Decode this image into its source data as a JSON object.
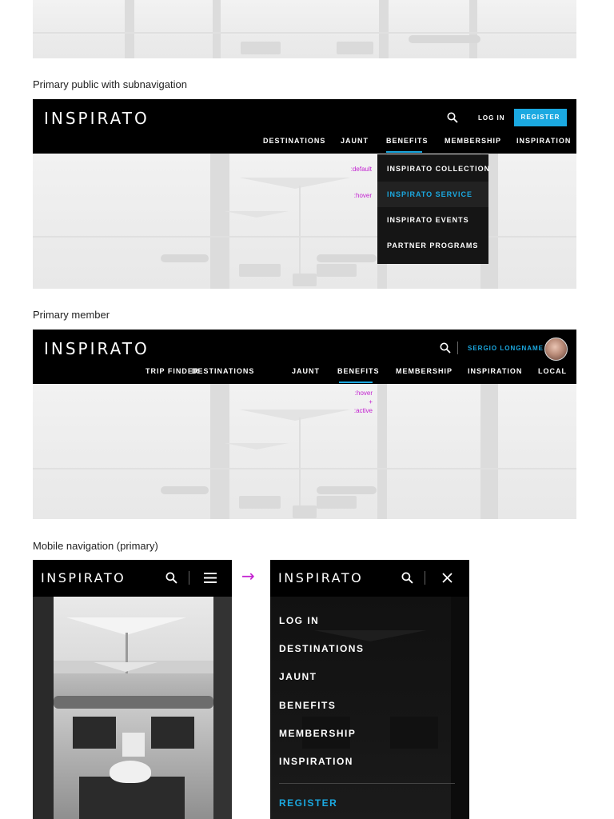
{
  "captions": {
    "public_sub": "Primary public with subnavigation",
    "member": "Primary member",
    "mobile": "Mobile navigation (primary)"
  },
  "brand": {
    "logo": "INSPIRATO"
  },
  "colors": {
    "accent": "#1ba9e1",
    "annotation": "#c21fd0",
    "nav_bg": "#000000",
    "dropdown_bg": "#151515"
  },
  "public_nav": {
    "login": "LOG IN",
    "register": "REGISTER",
    "items": [
      "DESTINATIONS",
      "JAUNT",
      "BENEFITS",
      "MEMBERSHIP",
      "INSPIRATION"
    ],
    "active_item": "BENEFITS",
    "dropdown": [
      "INSPIRATO COLLECTION",
      "INSPIRATO SERVICE",
      "INSPIRATO EVENTS",
      "PARTNER PROGRAMS"
    ],
    "hovered_dropdown_item": "INSPIRATO SERVICE",
    "state_labels": {
      "default": ":default",
      "hover": ":hover"
    }
  },
  "member_nav": {
    "user_name": "SERGIO LONGNAME",
    "items": [
      "TRIP FINDER",
      "DESTINATIONS",
      "JAUNT",
      "BENEFITS",
      "MEMBERSHIP",
      "INSPIRATION",
      "LOCAL"
    ],
    "active_item": "BENEFITS",
    "state_labels": {
      "hover": ":hover",
      "plus": "+",
      "active": ":active"
    }
  },
  "mobile_nav": {
    "arrow": "→",
    "menu_items": [
      "LOG IN",
      "DESTINATIONS",
      "JAUNT",
      "BENEFITS",
      "MEMBERSHIP",
      "INSPIRATION"
    ],
    "register": "REGISTER"
  },
  "icons": {
    "search": "search-icon",
    "menu": "hamburger-icon",
    "close": "close-icon",
    "avatar": "avatar"
  }
}
